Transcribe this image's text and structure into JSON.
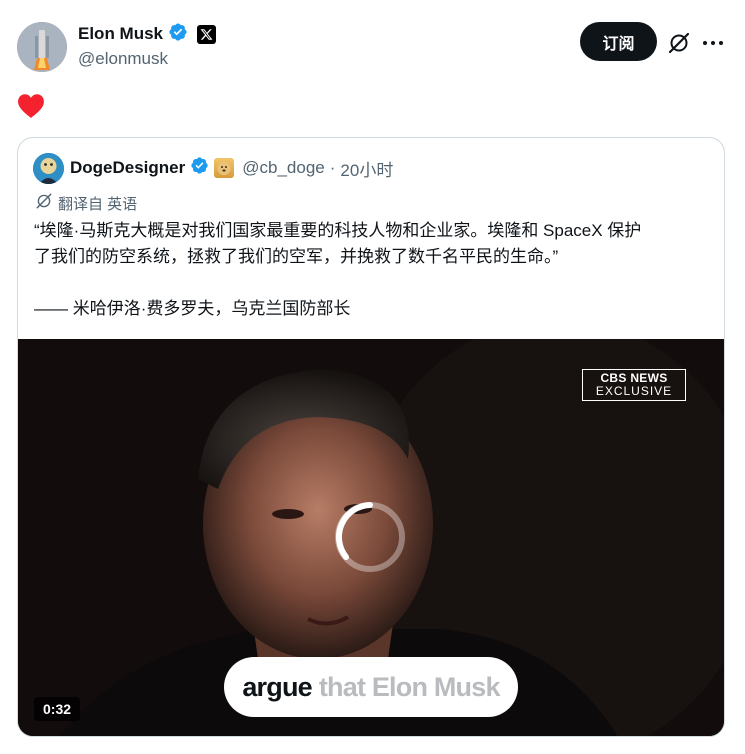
{
  "post": {
    "author": {
      "display_name": "Elon Musk",
      "handle": "@elonmusk",
      "verified_icon": "verified-badge-icon",
      "affiliation_icon": "x-logo-icon"
    },
    "subscribe_label": "订阅",
    "reaction_icon": "heart-icon"
  },
  "quote": {
    "author": {
      "display_name": "DogeDesigner",
      "handle": "@cb_doge",
      "time": "20小时"
    },
    "separator": "·",
    "translate": {
      "label": "翻译自 英语"
    },
    "text_line1": "“埃隆·马斯克大概是对我们国家最重要的科技人物和企业家。埃隆和 SpaceX 保护",
    "text_line2": "了我们的防空系统，拯救了我们的空军，并挽救了数千名平民的生命。”",
    "text_line3": "—— 米哈伊洛·费多罗夫，乌克兰国防部长"
  },
  "video": {
    "badge_line1": "CBS NEWS",
    "badge_line2": "EXCLUSIVE",
    "caption_strong": "argue",
    "caption_faint": "that Elon Musk",
    "duration": "0:32"
  },
  "colors": {
    "text_primary": "#0f1419",
    "text_secondary": "#536471",
    "verified_blue": "#1d9bf0",
    "heart_red": "#f4212e",
    "border": "#cfd9de"
  }
}
